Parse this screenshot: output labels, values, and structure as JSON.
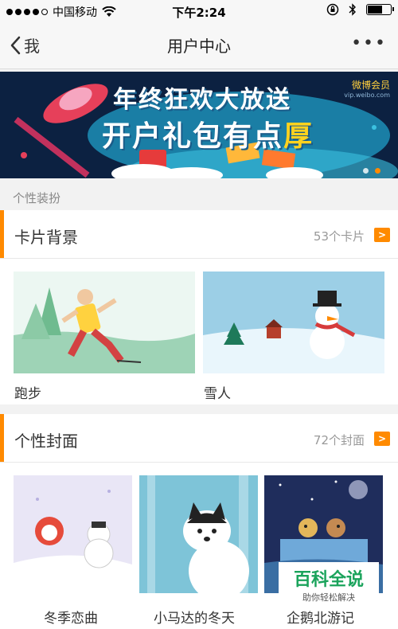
{
  "status_bar": {
    "carrier": "中国移动",
    "time": "下午2:24"
  },
  "nav": {
    "back_label": "我",
    "title": "用户中心",
    "more_label": "•••"
  },
  "banner": {
    "line1": "年终狂欢大放送",
    "line2_main": "开户礼包有点",
    "line2_highlight": "厚",
    "brand": "微博会员",
    "brand_url": "vip.weibo.com",
    "active_page": 2,
    "page_count": 2
  },
  "section_label": "个性装扮",
  "card_backgrounds": {
    "title": "卡片背景",
    "count": "53个卡片",
    "items": [
      {
        "label": "跑步"
      },
      {
        "label": "雪人"
      }
    ]
  },
  "covers": {
    "title": "个性封面",
    "count": "72个封面",
    "items": [
      {
        "label": "冬季恋曲"
      },
      {
        "label": "小马达的冬天"
      },
      {
        "label": "企鹅北游记"
      }
    ]
  },
  "watermark": {
    "big": "百科全说",
    "small": "助你轻松解决"
  },
  "colors": {
    "accent": "#ff8a00",
    "banner_bg": "#0c2141"
  }
}
